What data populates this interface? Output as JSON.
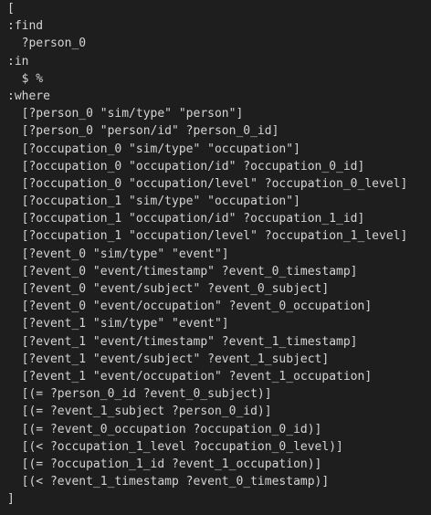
{
  "code": {
    "lines": [
      "[",
      ":find",
      "  ?person_0",
      ":in",
      "  $ %",
      ":where",
      "  [?person_0 \"sim/type\" \"person\"]",
      "  [?person_0 \"person/id\" ?person_0_id]",
      "  [?occupation_0 \"sim/type\" \"occupation\"]",
      "  [?occupation_0 \"occupation/id\" ?occupation_0_id]",
      "  [?occupation_0 \"occupation/level\" ?occupation_0_level]",
      "  [?occupation_1 \"sim/type\" \"occupation\"]",
      "  [?occupation_1 \"occupation/id\" ?occupation_1_id]",
      "  [?occupation_1 \"occupation/level\" ?occupation_1_level]",
      "  [?event_0 \"sim/type\" \"event\"]",
      "  [?event_0 \"event/timestamp\" ?event_0_timestamp]",
      "  [?event_0 \"event/subject\" ?event_0_subject]",
      "  [?event_0 \"event/occupation\" ?event_0_occupation]",
      "  [?event_1 \"sim/type\" \"event\"]",
      "  [?event_1 \"event/timestamp\" ?event_1_timestamp]",
      "  [?event_1 \"event/subject\" ?event_1_subject]",
      "  [?event_1 \"event/occupation\" ?event_1_occupation]",
      "  [(= ?person_0_id ?event_0_subject)]",
      "  [(= ?event_1_subject ?person_0_id)]",
      "  [(= ?event_0_occupation ?occupation_0_id)]",
      "  [(< ?occupation_1_level ?occupation_0_level)]",
      "  [(= ?occupation_1_id ?event_1_occupation)]",
      "  [(< ?event_1_timestamp ?event_0_timestamp)]",
      "]"
    ]
  }
}
